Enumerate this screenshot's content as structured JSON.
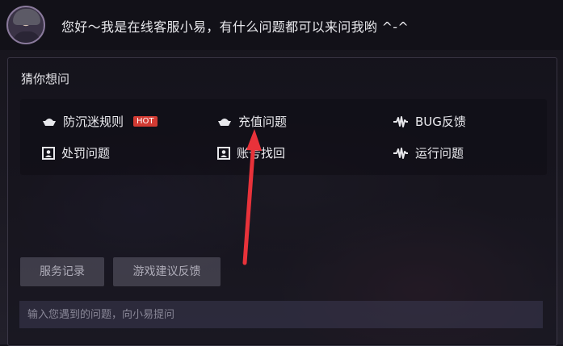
{
  "header": {
    "greeting": "您好～我是在线客服小易，有什么问题都可以来问我哟 ^-^"
  },
  "guess": {
    "title": "猜你想问",
    "items": [
      {
        "label": "防沉迷规则",
        "icon": "ingot-icon",
        "badge": "HOT"
      },
      {
        "label": "充值问题",
        "icon": "ingot-icon"
      },
      {
        "label": "BUG反馈",
        "icon": "waveform-icon"
      },
      {
        "label": "处罚问题",
        "icon": "portrait-frame-icon"
      },
      {
        "label": "账号找回",
        "icon": "portrait-frame-icon"
      },
      {
        "label": "运行问题",
        "icon": "waveform-icon"
      }
    ]
  },
  "actions": {
    "service_record": "服务记录",
    "game_feedback": "游戏建议反馈"
  },
  "input": {
    "placeholder": "输入您遇到的问题，向小易提问"
  },
  "colors": {
    "hot_badge": "#d23b33",
    "annotation_arrow": "#e8323a"
  }
}
